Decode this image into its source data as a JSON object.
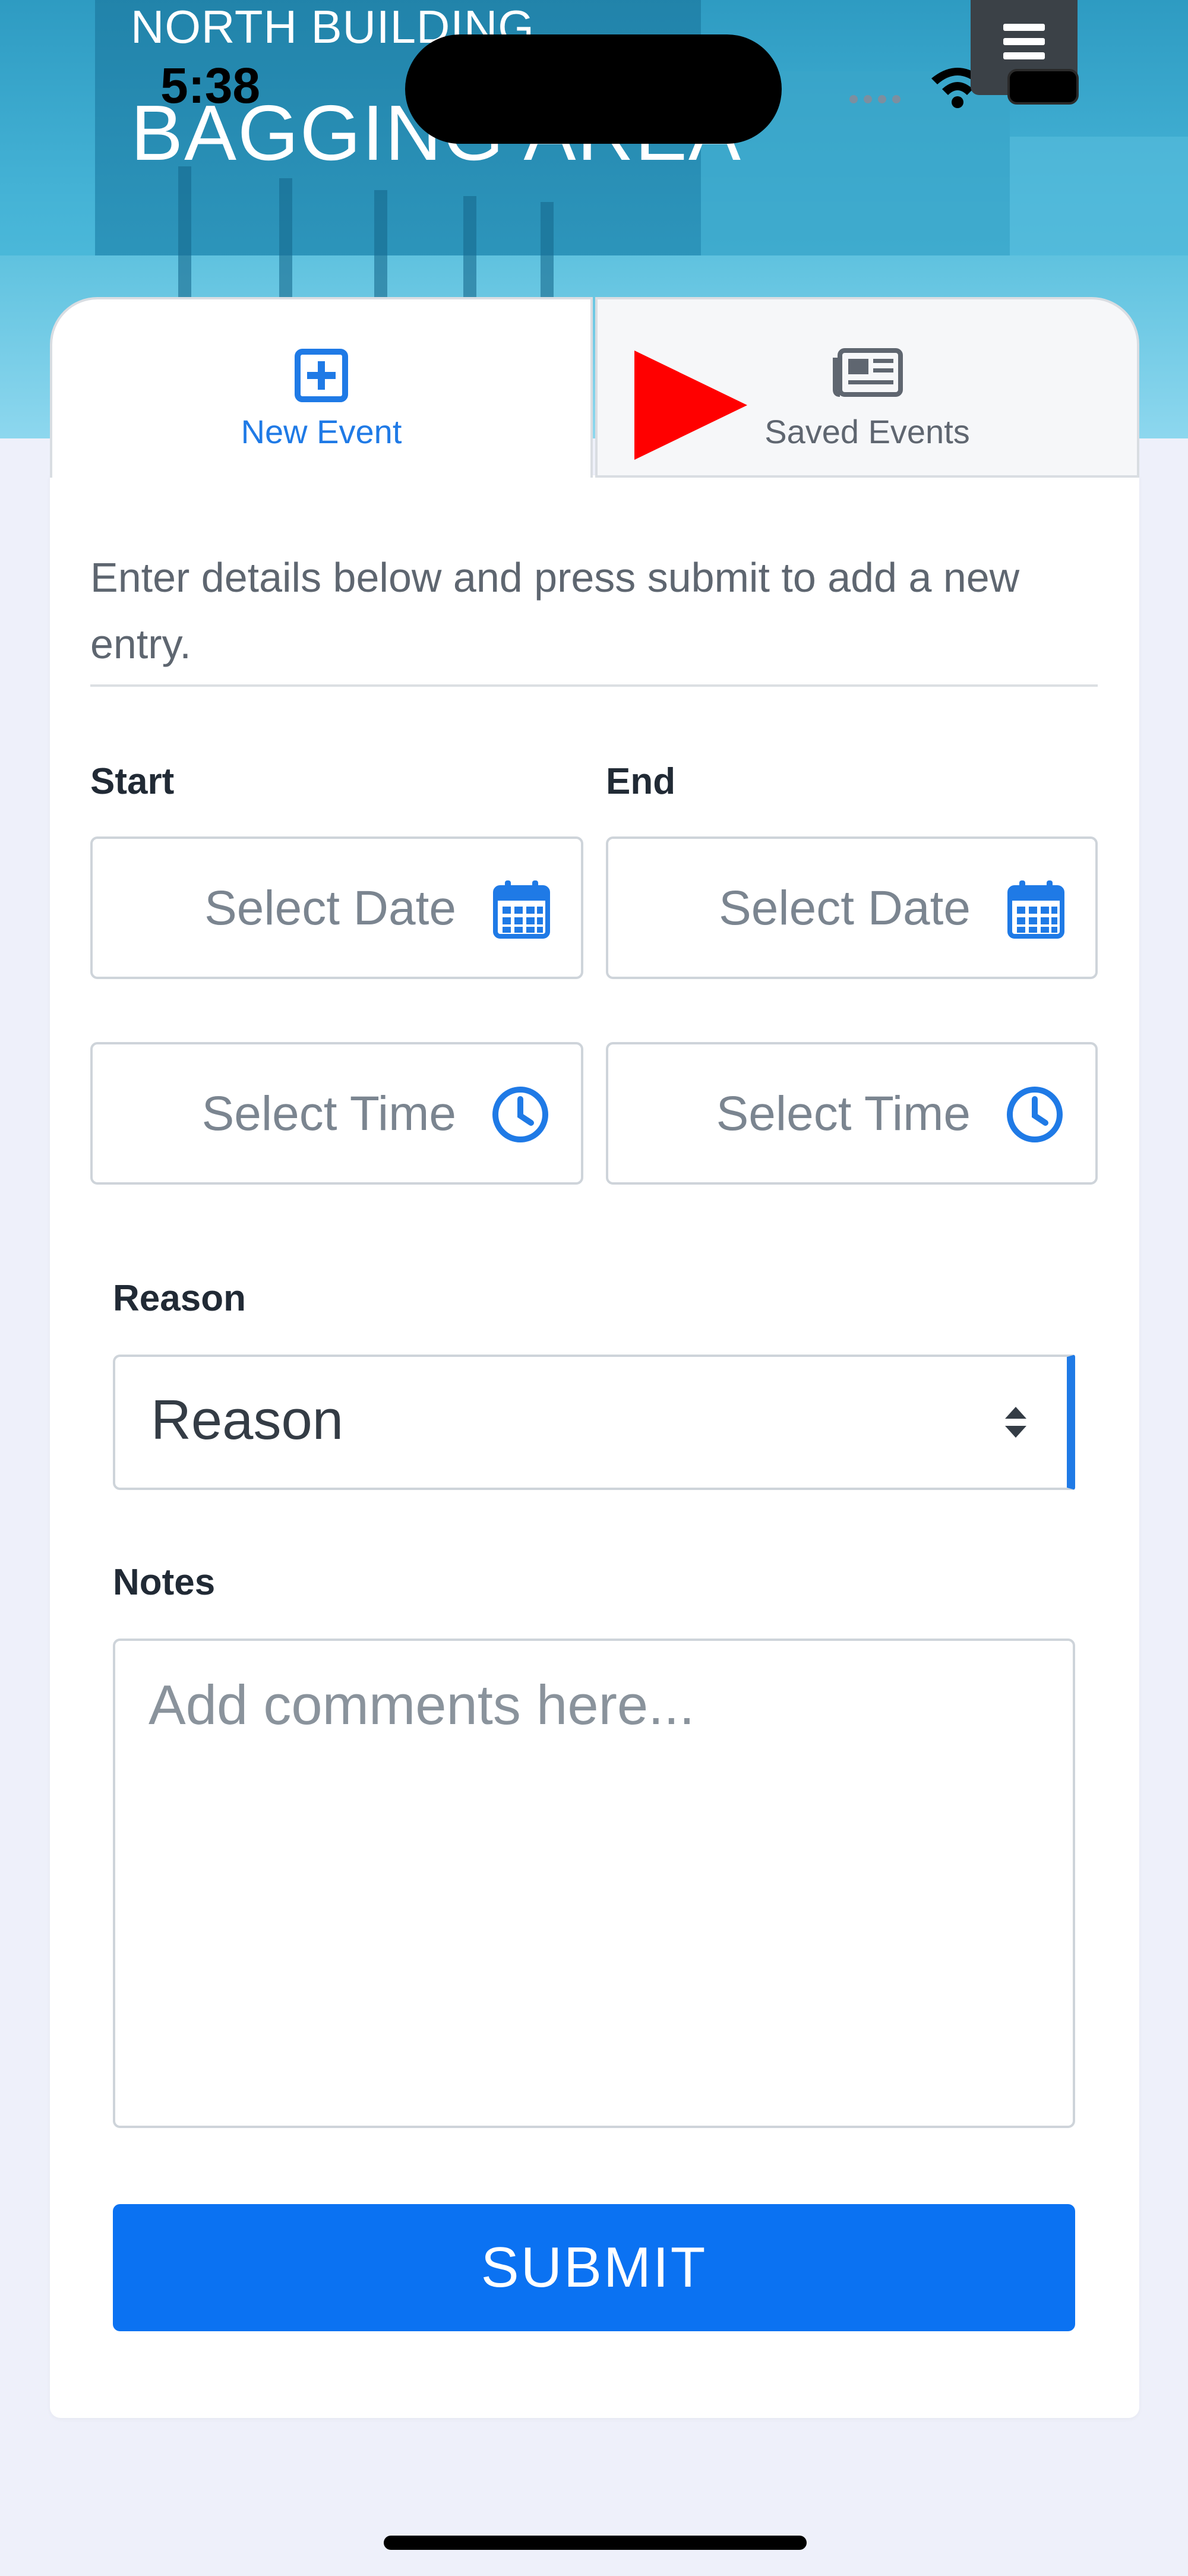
{
  "status_bar": {
    "time": "5:38"
  },
  "header": {
    "subtitle": "NORTH BUILDING",
    "title": "BAGGING AREA",
    "menu_icon": "hamburger-icon"
  },
  "tabs": [
    {
      "label": "New Event",
      "icon": "plus-square-icon",
      "active": true
    },
    {
      "label": "Saved Events",
      "icon": "newspaper-icon",
      "active": false
    }
  ],
  "form": {
    "intro": "Enter details below and press submit to add a new entry.",
    "start_label": "Start",
    "end_label": "End",
    "start_date_placeholder": "Select Date",
    "end_date_placeholder": "Select Date",
    "start_time_placeholder": "Select Time",
    "end_time_placeholder": "Select Time",
    "reason_label": "Reason",
    "reason_value": "Reason",
    "notes_label": "Notes",
    "notes_placeholder": "Add comments here...",
    "submit_label": "SUBMIT"
  },
  "colors": {
    "accent": "#1f7ae6",
    "submit": "#0b72f2",
    "annotation_arrow": "#ff0000"
  }
}
